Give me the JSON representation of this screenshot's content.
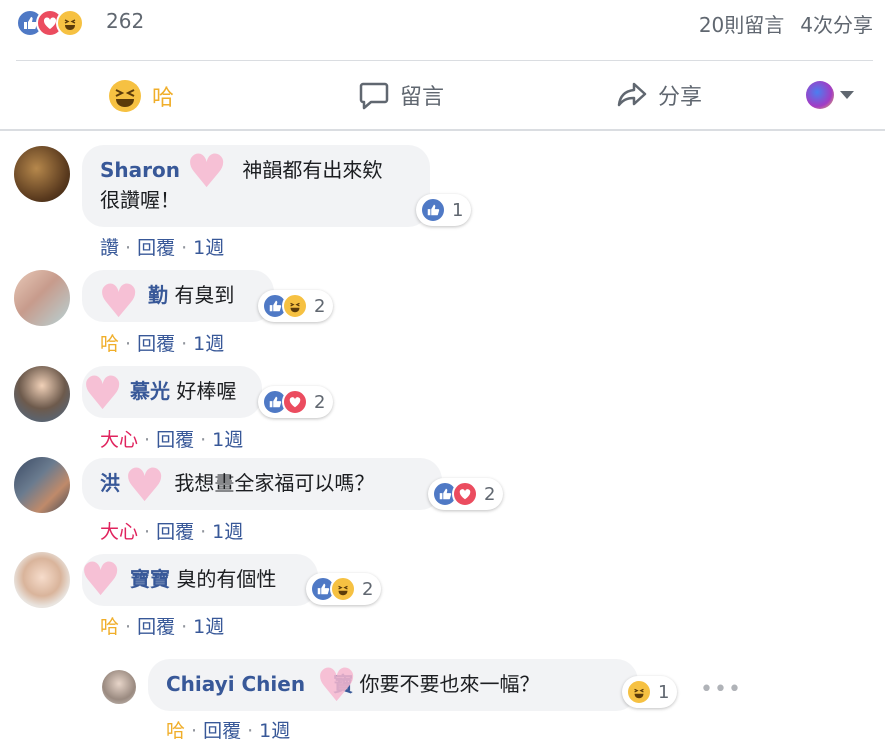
{
  "summary": {
    "reaction_count": "262",
    "comments_count": "20則留言",
    "shares_count": "4次分享"
  },
  "actions": {
    "haha_label": "哈",
    "comment_label": "留言",
    "share_label": "分享"
  },
  "comments": [
    {
      "name": "Sharon",
      "text_line1": "神韻都有出來欸",
      "text_line2": "很讚喔！",
      "reaction_count": "1",
      "reacted": "讚",
      "reply": "回覆",
      "time": "1週"
    },
    {
      "name": "勤",
      "text": "有臭到",
      "reaction_count": "2",
      "reacted": "哈",
      "reply": "回覆",
      "time": "1週"
    },
    {
      "name": "慕光",
      "text": "好棒喔",
      "reaction_count": "2",
      "reacted": "大心",
      "reply": "回覆",
      "time": "1週"
    },
    {
      "name": "洪",
      "text": "我想畫全家福可以嗎？",
      "reaction_count": "2",
      "reacted": "大心",
      "reply": "回覆",
      "time": "1週"
    },
    {
      "name": "寶寶",
      "text": "臭的有個性",
      "reaction_count": "2",
      "reacted": "哈",
      "reply": "回覆",
      "time": "1週"
    }
  ],
  "reply": {
    "name": "Chiayi Chien",
    "name_suffix": "寶",
    "text": "你要不要也來一幅？",
    "reaction_count": "1",
    "reacted": "哈",
    "reply": "回覆",
    "time": "1週",
    "more": "•••"
  },
  "colors": {
    "link": "#385898",
    "haha": "#f0ae2a",
    "love": "#e0245e",
    "like": "#4f79c5"
  }
}
